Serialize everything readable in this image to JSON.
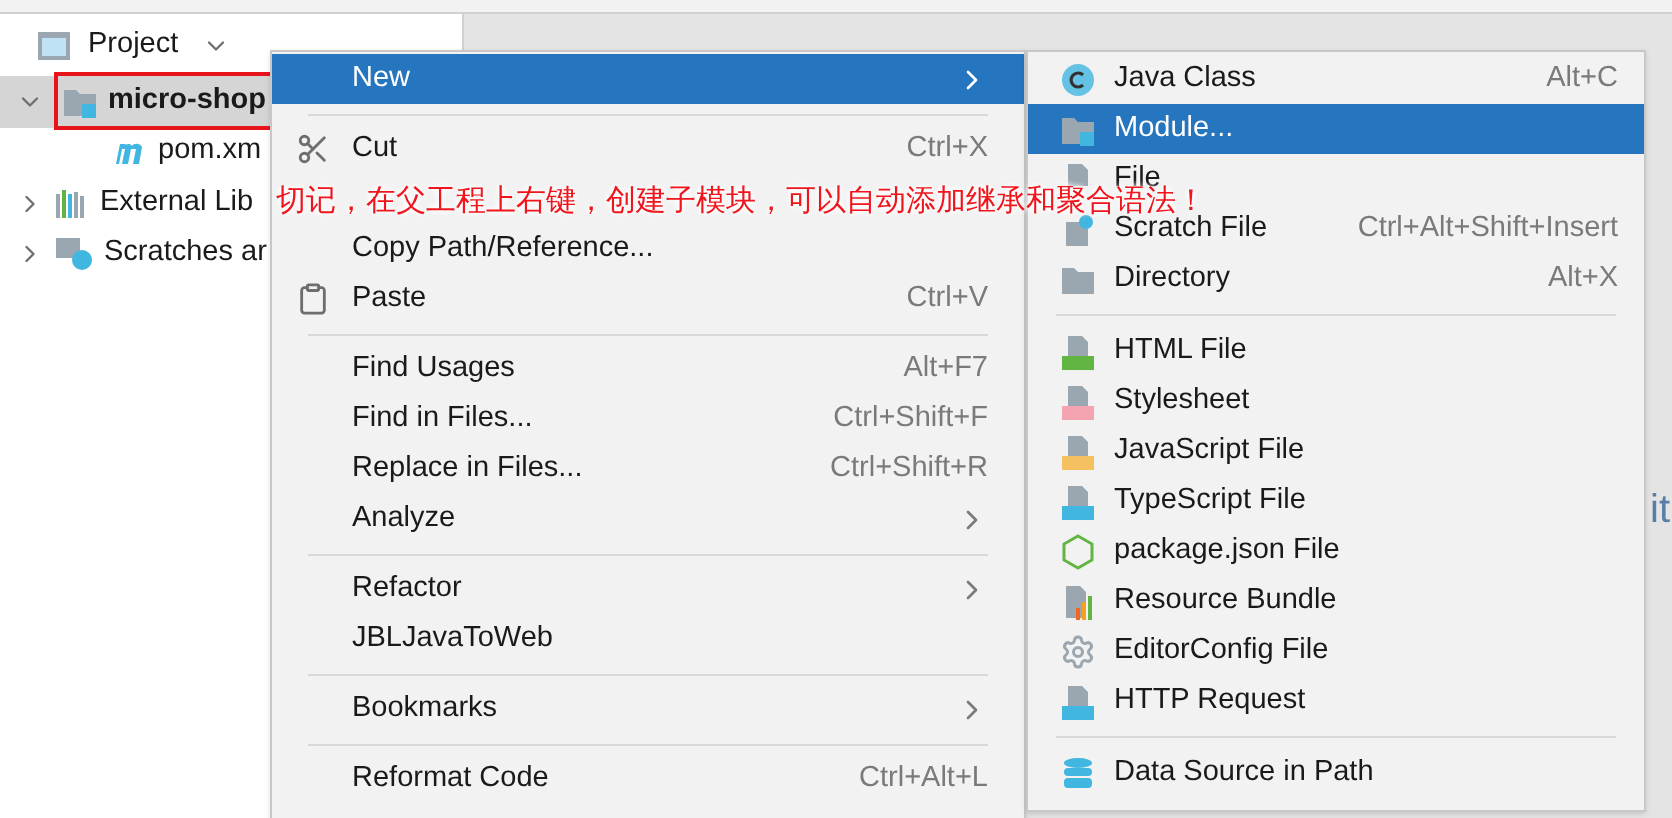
{
  "project_panel": {
    "title": "Project",
    "tree": [
      {
        "label": "micro-shop",
        "bold": true,
        "selected": true,
        "expanded": true,
        "framed": true,
        "children": [
          {
            "label": "pom.xm",
            "bold": false,
            "selected": false
          }
        ]
      },
      {
        "label": "External Lib",
        "bold": false,
        "selected": false,
        "expanded": false
      },
      {
        "label": "Scratches ar",
        "bold": false,
        "selected": false,
        "expanded": false
      }
    ]
  },
  "editor_hint": "it",
  "context_menu": {
    "groups": [
      [
        {
          "label": "New",
          "submenu": true,
          "selected": true
        }
      ],
      [
        {
          "label": "Cut",
          "shortcut": "Ctrl+X",
          "selected": false
        },
        {
          "label": "Copy Path/Reference...",
          "selected": false
        },
        {
          "label": "Paste",
          "shortcut": "Ctrl+V",
          "selected": false
        }
      ],
      [
        {
          "label": "Find Usages",
          "shortcut": "Alt+F7",
          "selected": false
        },
        {
          "label": "Find in Files...",
          "shortcut": "Ctrl+Shift+F",
          "selected": false
        },
        {
          "label": "Replace in Files...",
          "shortcut": "Ctrl+Shift+R",
          "selected": false
        },
        {
          "label": "Analyze",
          "submenu": true,
          "selected": false
        }
      ],
      [
        {
          "label": "Refactor",
          "submenu": true,
          "selected": false
        },
        {
          "label": "JBLJavaToWeb",
          "selected": false
        }
      ],
      [
        {
          "label": "Bookmarks",
          "submenu": true,
          "selected": false
        }
      ],
      [
        {
          "label": "Reformat Code",
          "shortcut": "Ctrl+Alt+L",
          "selected": false
        }
      ]
    ]
  },
  "new_submenu": {
    "groups": [
      [
        {
          "label": "Java Class",
          "shortcut": "Alt+C",
          "selected": false
        },
        {
          "label": "Module...",
          "selected": true
        },
        {
          "label": "File",
          "selected": false
        },
        {
          "label": "Scratch File",
          "shortcut": "Ctrl+Alt+Shift+Insert",
          "selected": false
        },
        {
          "label": "Directory",
          "shortcut": "Alt+X",
          "selected": false
        }
      ],
      [
        {
          "label": "HTML File",
          "selected": false
        },
        {
          "label": "Stylesheet",
          "selected": false
        },
        {
          "label": "JavaScript File",
          "selected": false
        },
        {
          "label": "TypeScript File",
          "selected": false
        },
        {
          "label": "package.json File",
          "selected": false
        },
        {
          "label": "Resource Bundle",
          "selected": false
        },
        {
          "label": "EditorConfig File",
          "selected": false
        },
        {
          "label": "HTTP Request",
          "selected": false
        }
      ],
      [
        {
          "label": "Data Source in Path",
          "selected": false
        }
      ]
    ]
  },
  "annotation": {
    "text": "切记，在父工程上右键，创建子模块，可以自动添加继承和聚合语法！"
  }
}
